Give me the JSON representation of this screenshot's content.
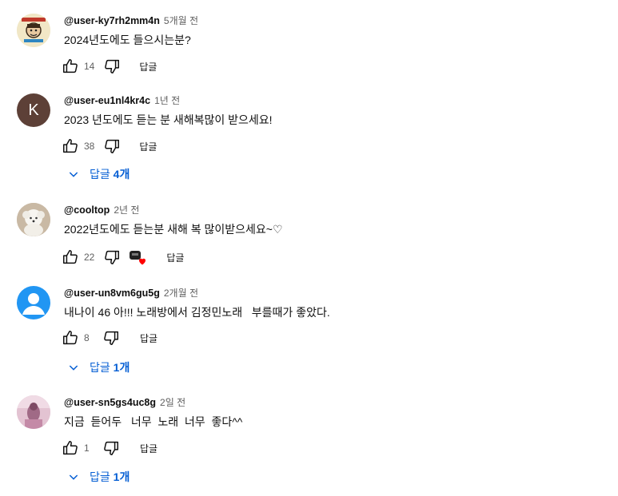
{
  "comments": [
    {
      "author": "@user-ky7rh2mm4n",
      "time": "5개월 전",
      "text": "2024년도에도 들으시는분?",
      "likes": "14",
      "reply_label": "답글",
      "avatar": {
        "type": "image",
        "icon": "cartoon-poster-avatar"
      }
    },
    {
      "author": "@user-eu1nl4kr4c",
      "time": "1년 전",
      "text": "2023 년도에도 듣는 분 새해복많이 받으세요!",
      "likes": "38",
      "reply_label": "답글",
      "avatar": {
        "type": "letter",
        "letter": "K",
        "color": "#5d4037"
      },
      "replies": {
        "prefix": "답글 ",
        "count": "4개"
      }
    },
    {
      "author": "@cooltop",
      "time": "2년 전",
      "text": "2022년도에도 듣는분 새해 복 많이받으세요~♡",
      "likes": "22",
      "reply_label": "답글",
      "avatar": {
        "type": "image",
        "icon": "white-puppy-avatar"
      },
      "creator_heart": true
    },
    {
      "author": "@user-un8vm6gu5g",
      "time": "2개월 전",
      "text": "내나이 46 아!!! 노래방에서 김정민노래   부를때가 좋았다.",
      "likes": "8",
      "reply_label": "답글",
      "avatar": {
        "type": "default",
        "color": "#2196f3"
      },
      "replies": {
        "prefix": "답글 ",
        "count": "1개"
      }
    },
    {
      "author": "@user-sn5gs4uc8g",
      "time": "2일 전",
      "text": "지금  듣어두   너무  노래  너무  좋다^^",
      "likes": "1",
      "reply_label": "답글",
      "avatar": {
        "type": "image",
        "icon": "pink-photo-avatar"
      },
      "replies": {
        "prefix": "답글 ",
        "count": "1개"
      }
    }
  ],
  "colors": {
    "link": "#065fd4",
    "heart": "#ff0000",
    "secondary_text": "#606060"
  }
}
